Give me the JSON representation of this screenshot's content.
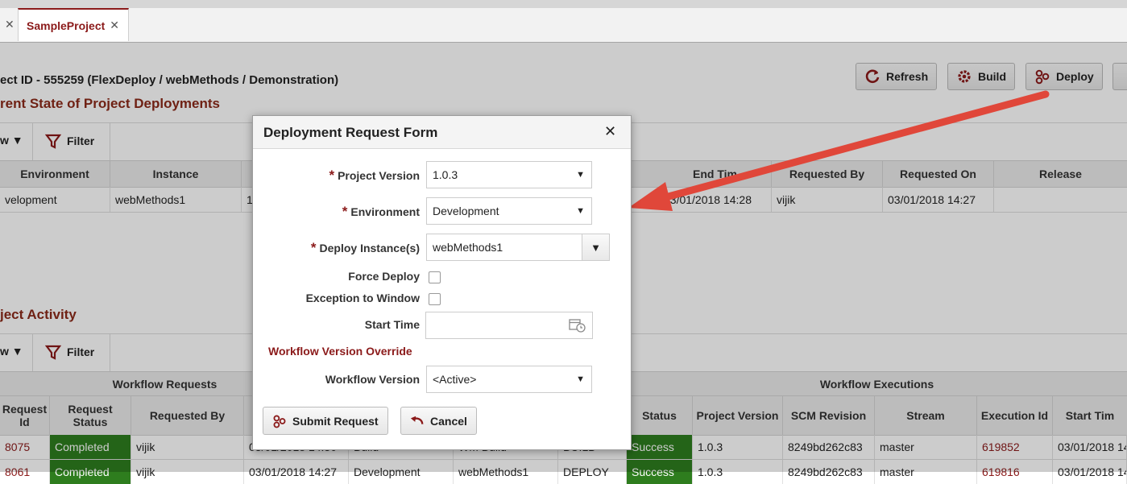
{
  "tabs": {
    "prev_close": "✕",
    "active_label": "SampleProject",
    "active_close": "✕"
  },
  "header": {
    "project_line": "ect ID - 555259 (FlexDeploy / webMethods / Demonstration)",
    "deployments_title": "rent State of Project Deployments",
    "activity_title": "ject Activity"
  },
  "actions": {
    "refresh": "Refresh",
    "build": "Build",
    "deploy": "Deploy"
  },
  "toolbar": {
    "view": "w",
    "filter": "Filter"
  },
  "deployments_table": {
    "headers": {
      "environment": "Environment",
      "instance": "Instance",
      "end_time": "End Tim",
      "requested_by": "Requested By",
      "requested_on": "Requested On",
      "release": "Release"
    },
    "row": {
      "environment": "velopment",
      "instance": "webMethods1",
      "col3": "1",
      "end_time": "03/01/2018 14:28",
      "requested_by": "vijik",
      "requested_on": "03/01/2018 14:27",
      "release": ""
    }
  },
  "workflow_requests": {
    "group_header": "Workflow Requests",
    "headers": {
      "request_id": "Request Id",
      "request_status": "Request Status",
      "requested_by": "Requested By"
    },
    "rows": [
      {
        "id": "8075",
        "status": "Completed",
        "by": "vijik"
      },
      {
        "id": "8061",
        "status": "Completed",
        "by": "vijik"
      }
    ]
  },
  "workflow_executions": {
    "group_header": "Workflow Executions",
    "headers": {
      "status": "Status",
      "project_version": "Project Version",
      "scm_revision": "SCM Revision",
      "stream": "Stream",
      "execution_id": "Execution Id",
      "start_time": "Start Tim"
    },
    "rows": [
      {
        "status": "Success",
        "version": "1.0.3",
        "scm": "8249bd262c83",
        "stream": "master",
        "exec_id": "619852",
        "start": "03/01/2018 14"
      },
      {
        "status": "Success",
        "version": "1.0.3",
        "scm": "8249bd262c83",
        "stream": "master",
        "exec_id": "619816",
        "start": "03/01/2018 14"
      }
    ],
    "hidden_row2": {
      "date": "03/01/2018 14:27",
      "env": "Development",
      "inst": "webMethods1",
      "type": "DEPLOY"
    },
    "hidden_row1": {
      "date": "03/01/2018 14:30",
      "kind": "Build",
      "wf": "WM Build",
      "type": "BUILD"
    }
  },
  "dialog": {
    "title": "Deployment Request Form",
    "close": "✕",
    "fields": {
      "project_version": {
        "label": "Project Version",
        "value": "1.0.3"
      },
      "environment": {
        "label": "Environment",
        "value": "Development"
      },
      "deploy_instances": {
        "label": "Deploy Instance(s)",
        "value": "webMethods1"
      },
      "force_deploy": {
        "label": "Force Deploy",
        "checked": false
      },
      "exception_to_window": {
        "label": "Exception to Window",
        "checked": false
      },
      "start_time": {
        "label": "Start Time",
        "value": ""
      },
      "override_heading": "Workflow Version Override",
      "workflow_version": {
        "label": "Workflow Version",
        "value": "<Active>"
      }
    },
    "required_marker": "*",
    "submit": "Submit Request",
    "cancel": "Cancel"
  },
  "colors": {
    "accent": "#8b1a1a",
    "success": "#2e7d1e",
    "arrow": "#e0473a"
  }
}
